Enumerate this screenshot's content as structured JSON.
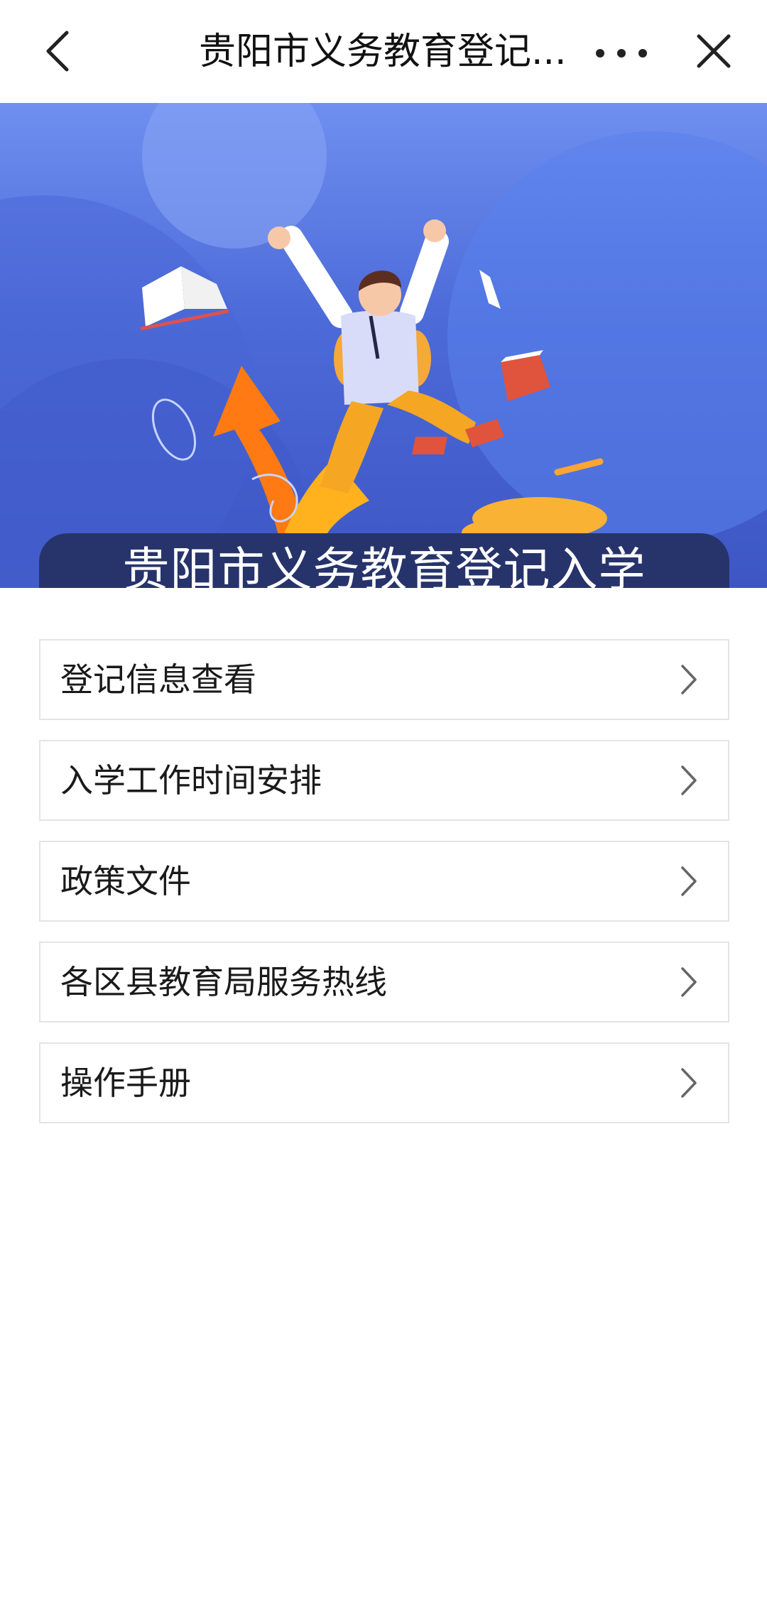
{
  "header": {
    "title": "贵阳市义务教育登记...",
    "back_icon": "chevron-left-icon",
    "more_icon": "more-dots-icon",
    "close_icon": "close-icon"
  },
  "banner": {
    "caption": "贵阳市义务教育登记入学",
    "colors": {
      "sky_top": "#6f8ff0",
      "sky_bottom": "#3d56c4",
      "arrow": "#ff7a12",
      "caption_bg": "#27346b"
    }
  },
  "menu": {
    "items": [
      {
        "label": "登记信息查看"
      },
      {
        "label": "入学工作时间安排"
      },
      {
        "label": "政策文件"
      },
      {
        "label": "各区县教育局服务热线"
      },
      {
        "label": "操作手册"
      }
    ],
    "chevron_icon": "chevron-right-icon"
  }
}
